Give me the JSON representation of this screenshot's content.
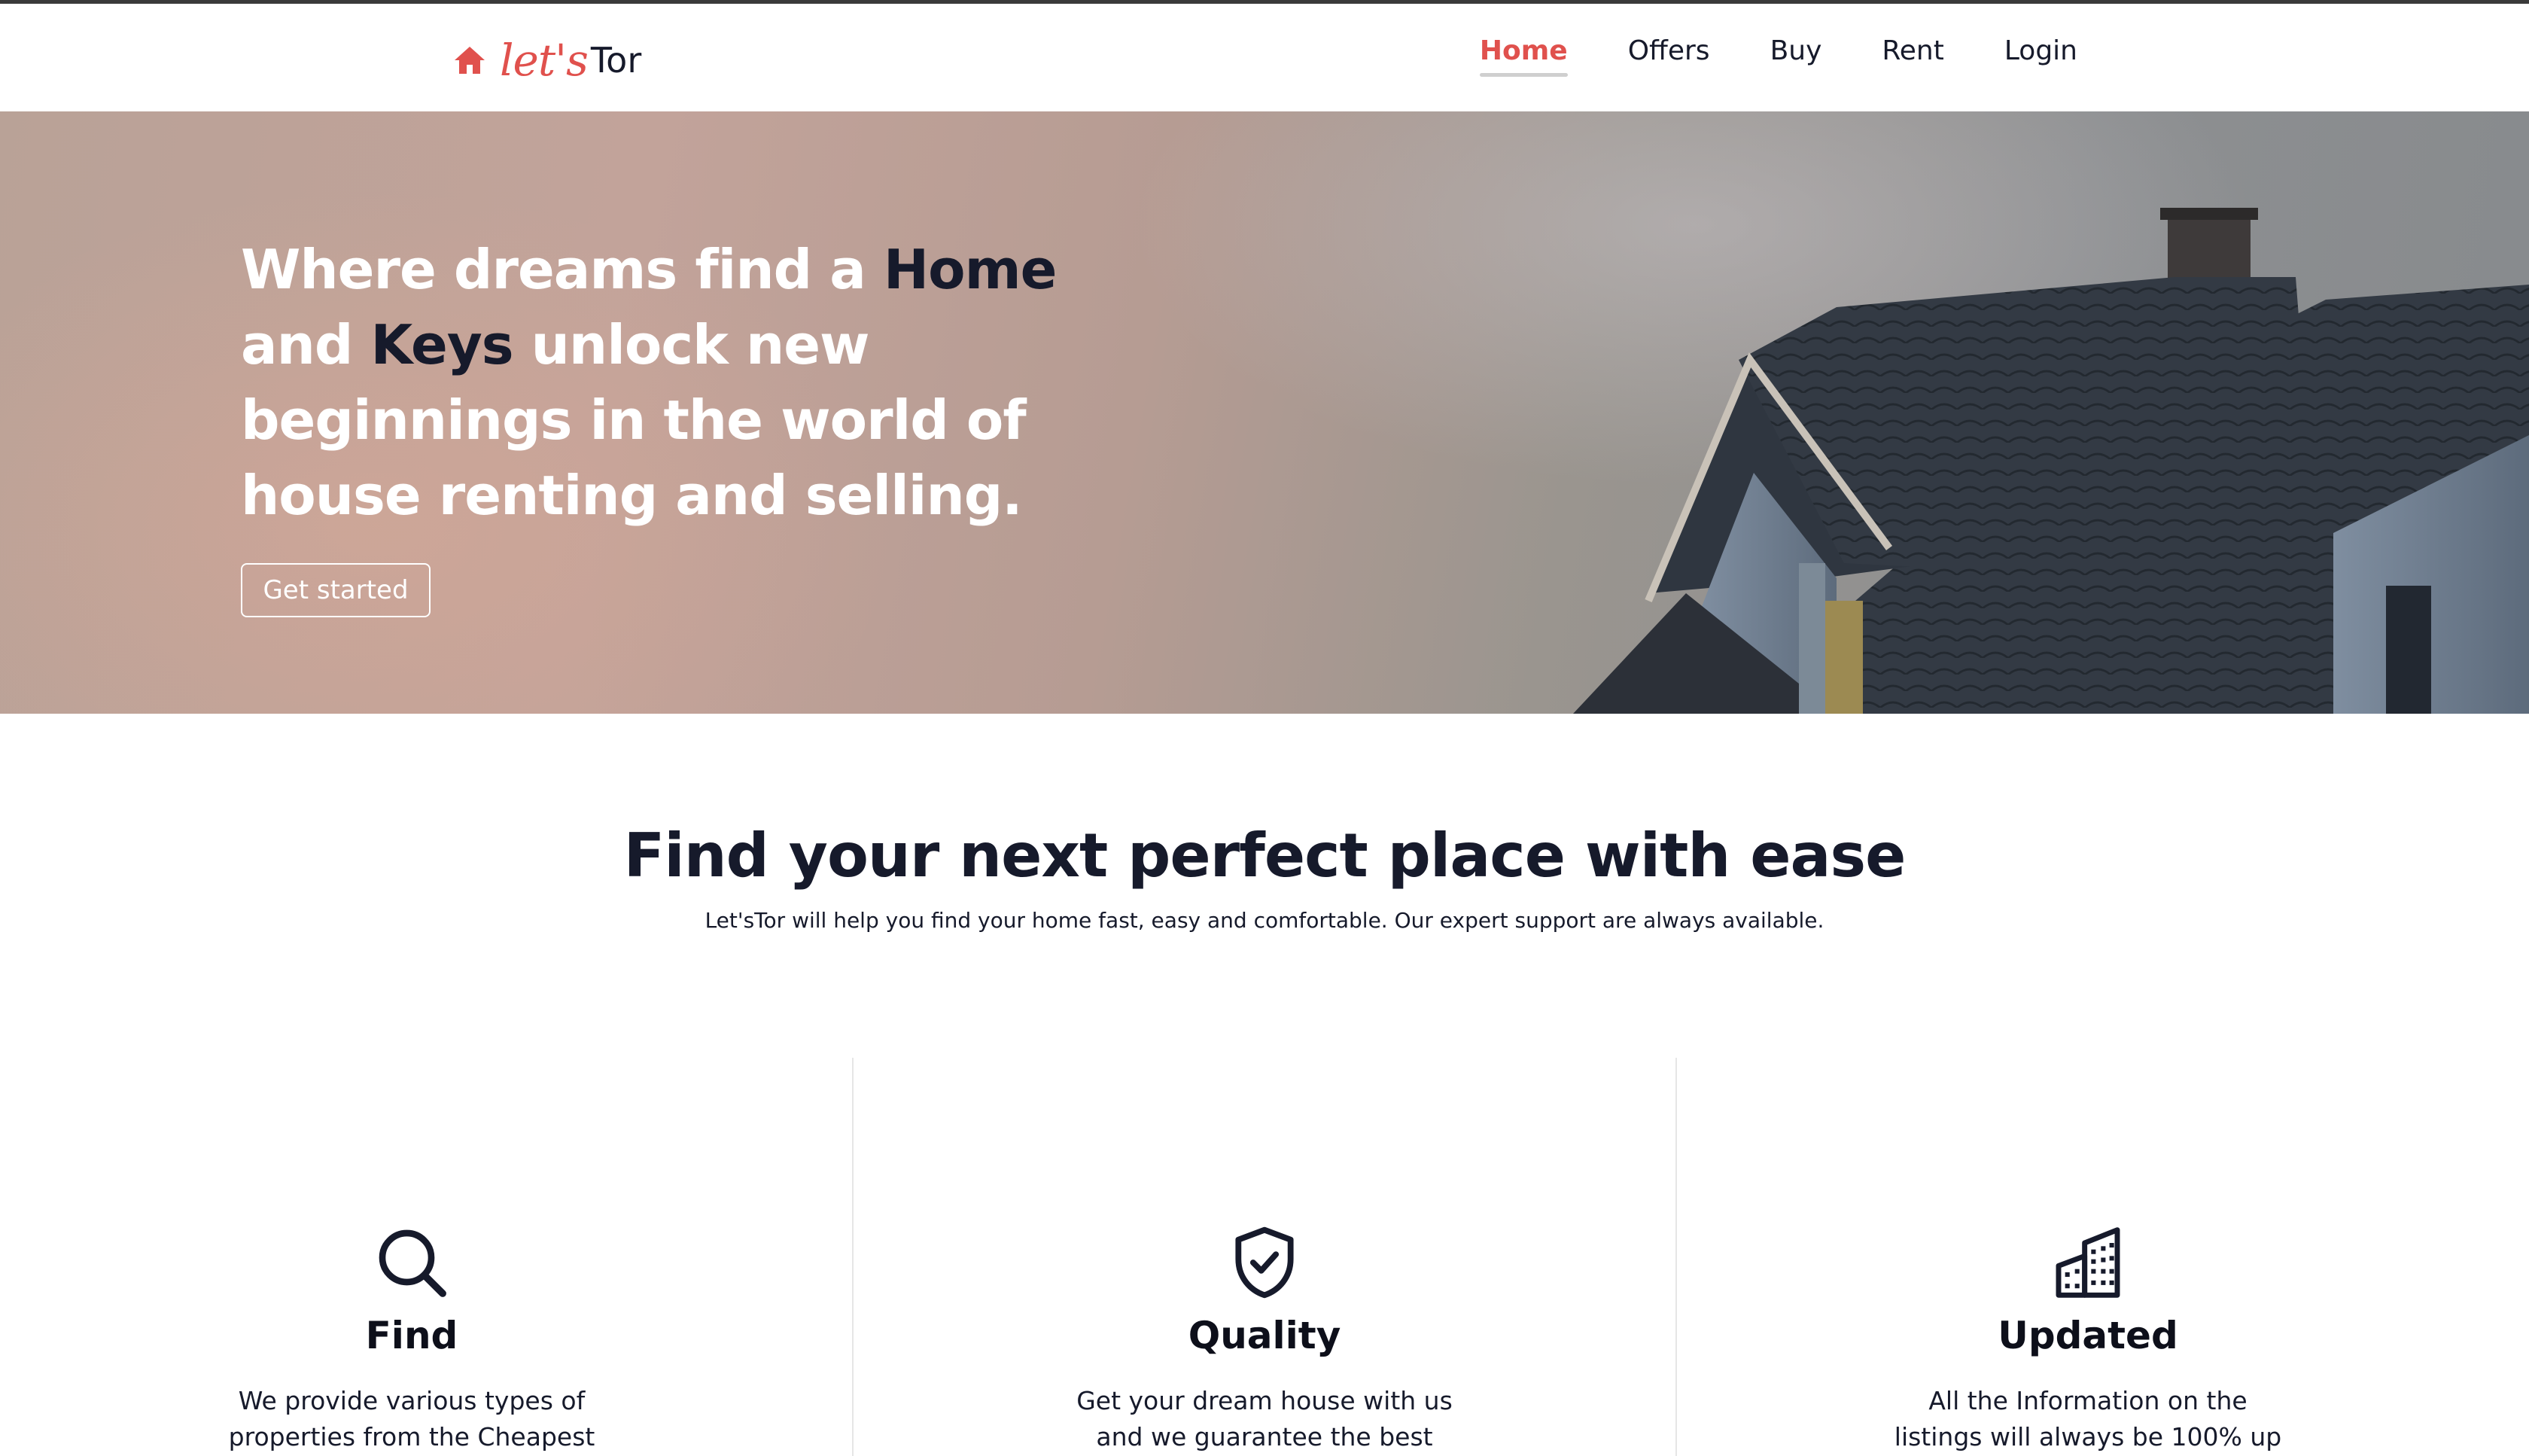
{
  "brand": {
    "script": "let's",
    "name": "Tor",
    "accent_color": "#e0514d",
    "dark_color": "#161a2b"
  },
  "nav": {
    "items": [
      {
        "label": "Home",
        "active": true
      },
      {
        "label": "Offers"
      },
      {
        "label": "Buy"
      },
      {
        "label": "Rent"
      },
      {
        "label": "Login"
      }
    ]
  },
  "hero": {
    "headline_part1": "Where dreams find a ",
    "headline_highlight1": "Home",
    "headline_part2": " and ",
    "headline_highlight2": "Keys",
    "headline_part3": " unlock new beginnings in the world of house renting and selling.",
    "cta_label": "Get started"
  },
  "section": {
    "title": "Find your next perfect place with ease",
    "subtitle": "Let'sTor will help you find your home fast, easy and comfortable. Our expert support are always available."
  },
  "features": [
    {
      "icon": "search-icon",
      "title": "Find",
      "desc": "We provide various types of properties from the Cheapest"
    },
    {
      "icon": "shield-check-icon",
      "title": "Quality",
      "desc": "Get your dream house with us and we guarantee the best"
    },
    {
      "icon": "buildings-icon",
      "title": "Updated",
      "desc": "All the Information on the listings will always be 100% up"
    }
  ]
}
